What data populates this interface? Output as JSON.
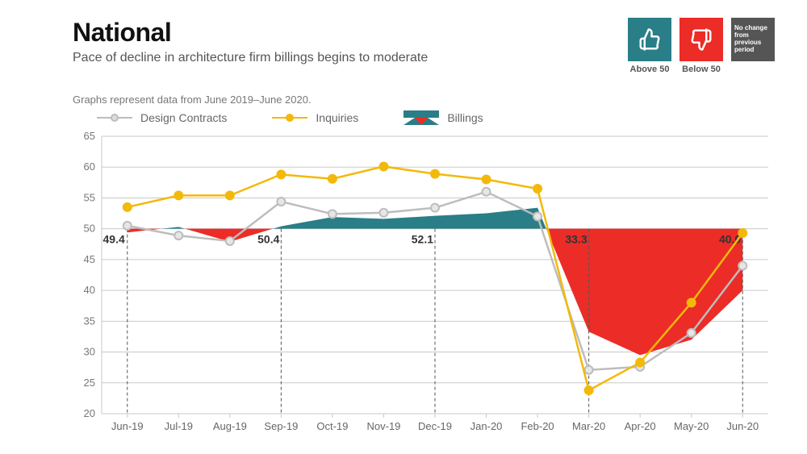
{
  "header": {
    "title": "National",
    "subtitle": "Pace of decline in architecture firm billings begins to moderate"
  },
  "badges": {
    "above": "Above 50",
    "below": "Below 50",
    "nochange": "No change from previous period"
  },
  "note": "Graphs represent data from June 2019–June 2020.",
  "legend": {
    "design": "Design Contracts",
    "inquiries": "Inquiries",
    "billings": "Billings"
  },
  "colors": {
    "teal": "#2a7e87",
    "red": "#ec2c27",
    "yellow": "#f3b90a",
    "lightgray": "#bdbdbd",
    "grid": "#c9c9c9"
  },
  "chart_data": {
    "type": "line",
    "title": "National",
    "xlabel": "",
    "ylabel": "",
    "ylim": [
      20,
      65
    ],
    "yticks": [
      20,
      25,
      30,
      35,
      40,
      45,
      50,
      55,
      60,
      65
    ],
    "categories": [
      "Jun-19",
      "Jul-19",
      "Aug-19",
      "Sep-19",
      "Oct-19",
      "Nov-19",
      "Dec-19",
      "Jan-20",
      "Feb-20",
      "Mar-20",
      "Apr-20",
      "May-20",
      "Jun-20"
    ],
    "series": [
      {
        "name": "Billings",
        "values": [
          49.4,
          50.3,
          47.9,
          50.4,
          51.9,
          51.6,
          52.1,
          52.5,
          53.4,
          33.3,
          29.5,
          32.0,
          40.0
        ]
      },
      {
        "name": "Inquiries",
        "values": [
          53.5,
          55.4,
          55.4,
          58.8,
          58.1,
          60.1,
          58.9,
          58.0,
          56.5,
          23.8,
          28.3,
          38.0,
          49.3
        ]
      },
      {
        "name": "Design Contracts",
        "values": [
          50.5,
          48.9,
          48.0,
          54.4,
          52.4,
          52.6,
          53.4,
          56.0,
          52.0,
          27.1,
          27.6,
          33.1,
          44.0
        ]
      }
    ],
    "annotations": [
      {
        "x_index": 0,
        "value": 49.4,
        "label": "49.4"
      },
      {
        "x_index": 3,
        "value": 50.4,
        "label": "50.4"
      },
      {
        "x_index": 6,
        "value": 52.1,
        "label": "52.1"
      },
      {
        "x_index": 9,
        "value": 33.3,
        "label": "33.3"
      },
      {
        "x_index": 12,
        "value": 40.0,
        "label": "40.0"
      }
    ]
  }
}
